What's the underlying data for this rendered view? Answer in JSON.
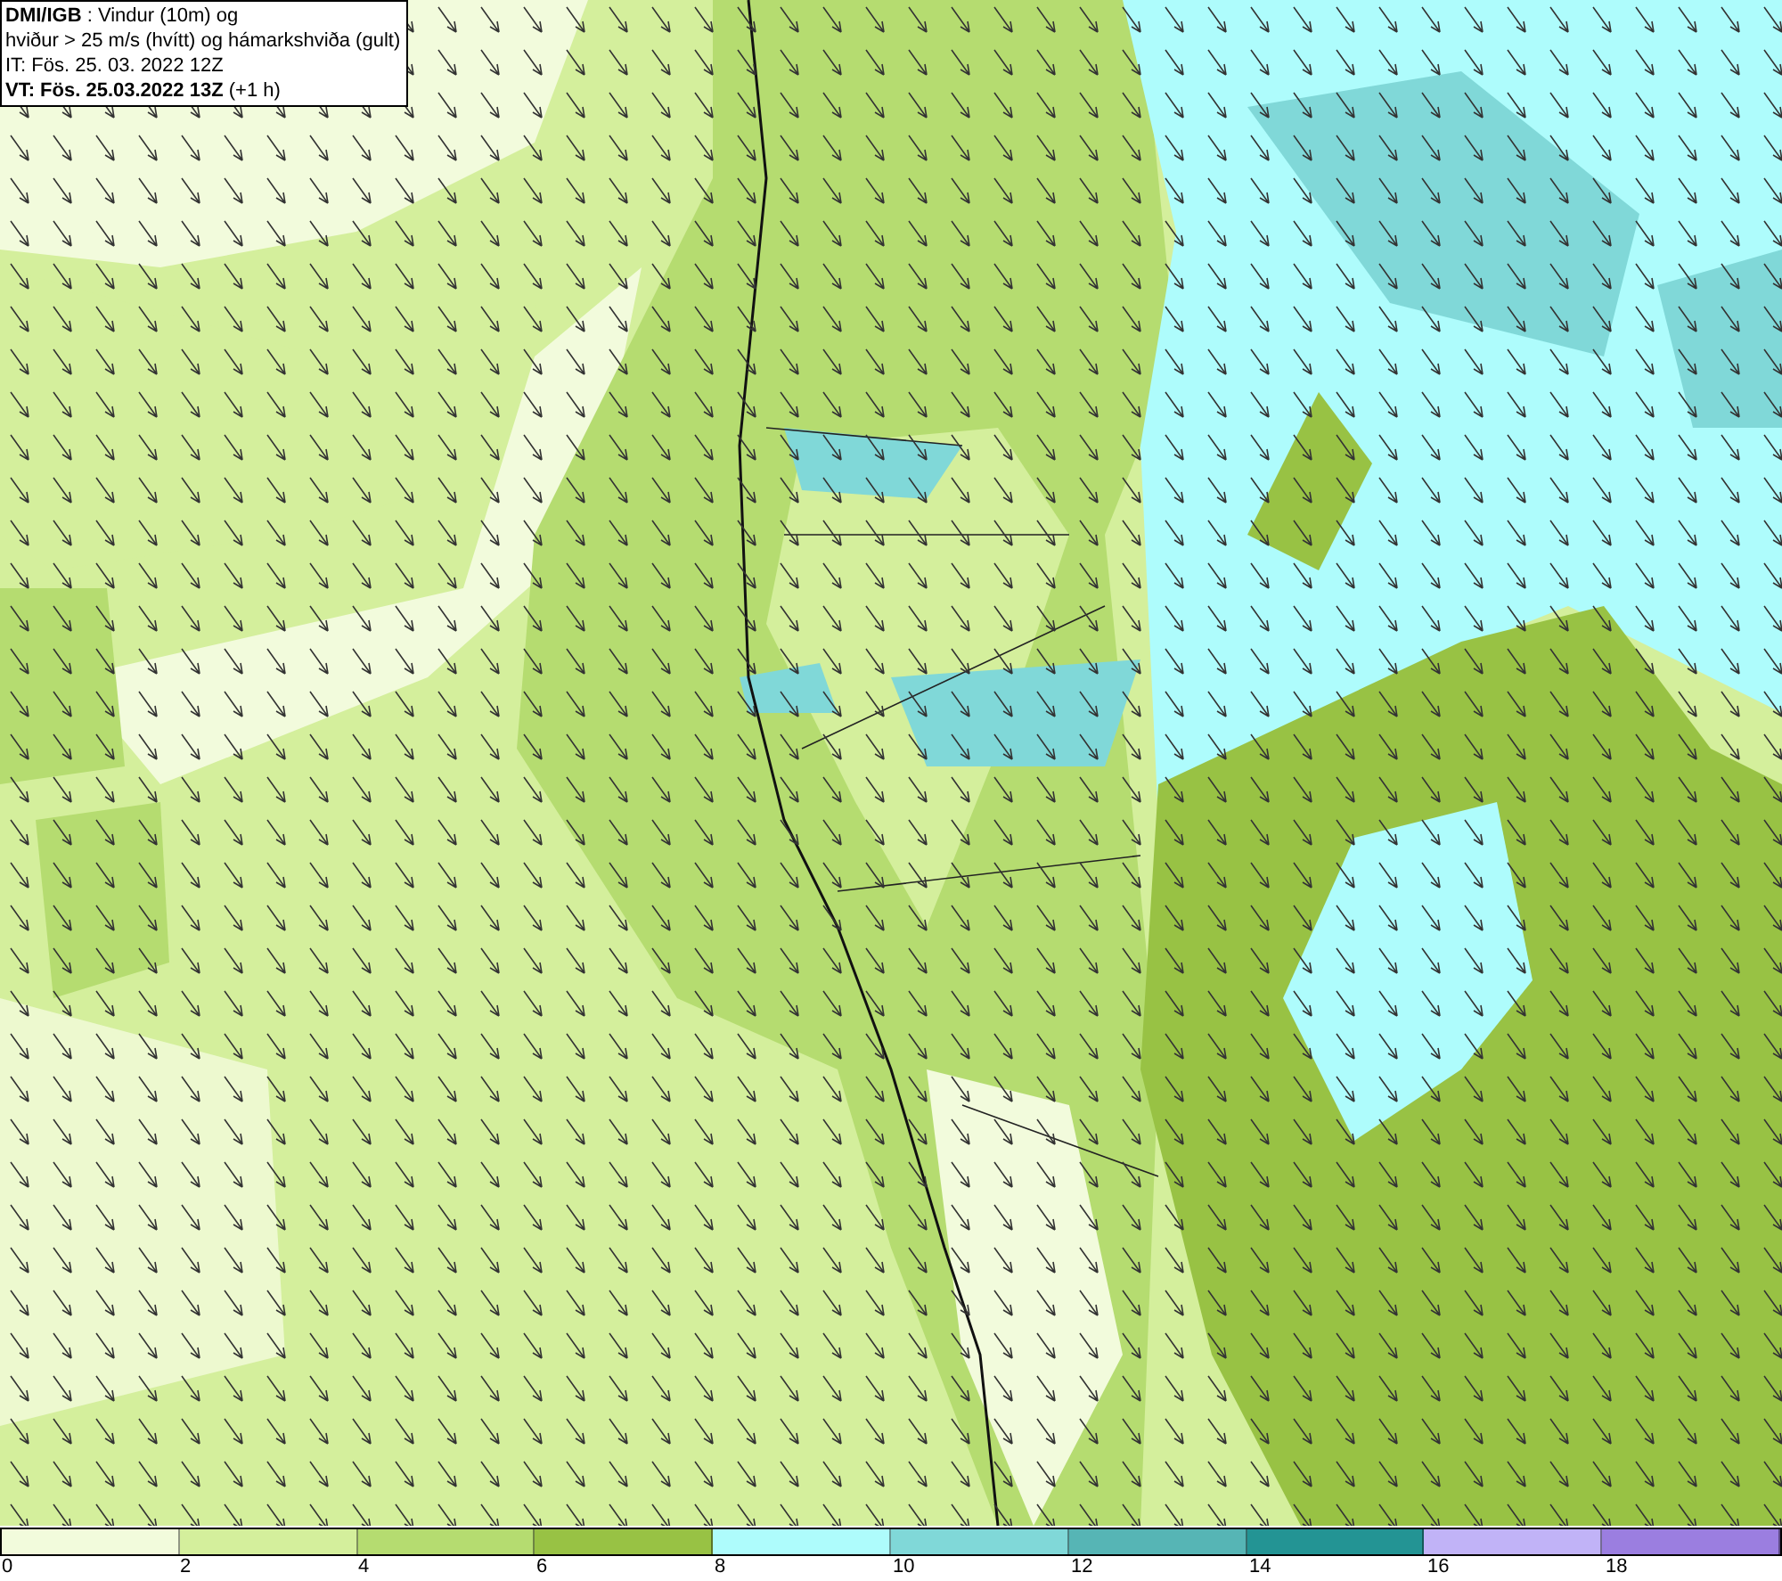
{
  "header": {
    "lines": [
      "**DMI/IGB** : Vindur (10m) og",
      "hviður > 25 m/s (hvítt) og hámarkshviða (gult)",
      "IT: Fös. 25. 03. 2022 12Z",
      "**VT: Fös. 25.03.2022 13Z** (+1 h)"
    ]
  },
  "legend": {
    "bins": [
      {
        "color": "#f2fbdc"
      },
      {
        "color": "#d4ef9c"
      },
      {
        "color": "#b5dc70"
      },
      {
        "color": "#98c244"
      },
      {
        "color": "#aefcfc"
      },
      {
        "color": "#80d8d8"
      },
      {
        "color": "#56b5b5"
      },
      {
        "color": "#239494"
      },
      {
        "color": "#c1b3f7"
      },
      {
        "color": "#9b7ee0"
      }
    ],
    "labels": [
      "0",
      "2",
      "4",
      "6",
      "8",
      "10",
      "12",
      "14",
      "16",
      "18"
    ]
  }
}
